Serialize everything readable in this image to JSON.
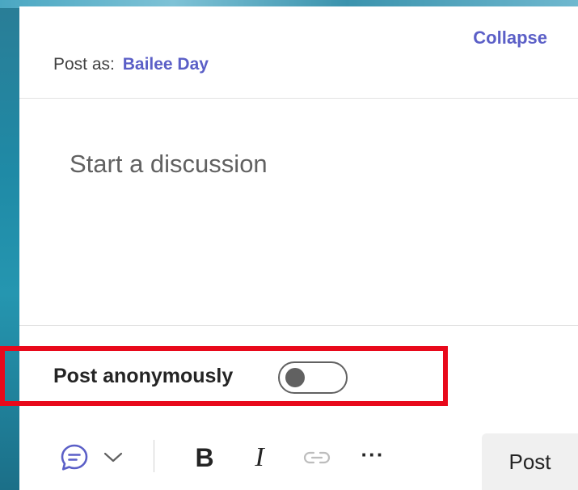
{
  "header": {
    "collapse_label": "Collapse",
    "post_as_label": "Post as:",
    "post_as_name": "Bailee Day"
  },
  "editor": {
    "placeholder": "Start a discussion",
    "value": ""
  },
  "anonymous": {
    "label": "Post anonymously",
    "enabled": false
  },
  "toolbar": {
    "post_type_icon": "chat-bubble-icon",
    "dropdown_icon": "chevron-down-icon",
    "bold_label": "B",
    "italic_label": "I",
    "link_icon": "link-icon",
    "more_label": "···",
    "post_label": "Post"
  },
  "colors": {
    "accent": "#5b5fc7",
    "highlight": "#e8091b",
    "toggle_off": "#616161"
  }
}
